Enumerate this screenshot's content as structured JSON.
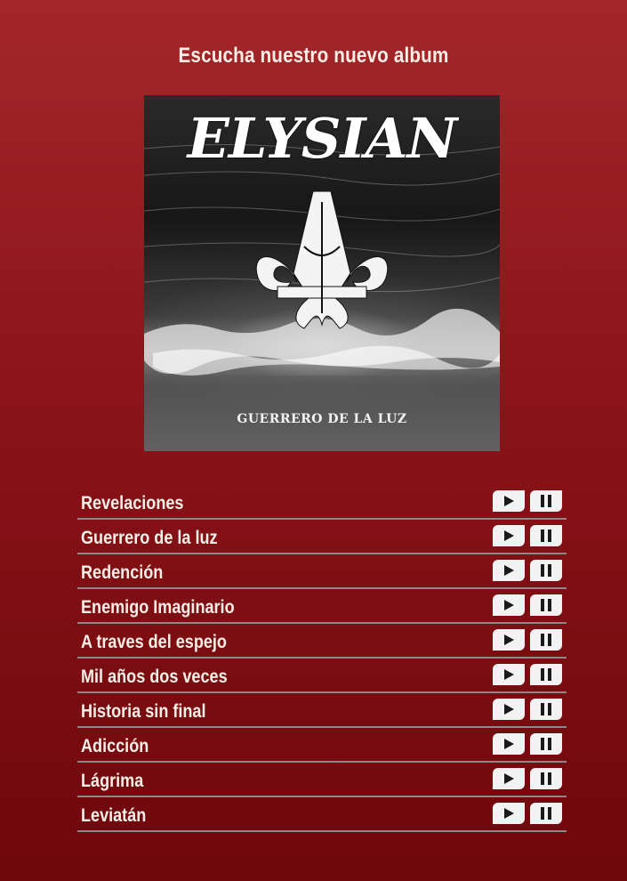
{
  "header": {
    "title": "Escucha nuestro nuevo album"
  },
  "album": {
    "band_name": "ELYSIAN",
    "album_title": "GUERRERO DE LA LUZ"
  },
  "tracks": [
    {
      "name": "Revelaciones"
    },
    {
      "name": "Guerrero de la luz"
    },
    {
      "name": "Redención"
    },
    {
      "name": "Enemigo Imaginario"
    },
    {
      "name": "A traves del espejo"
    },
    {
      "name": "Mil años dos veces"
    },
    {
      "name": "Historia sin final"
    },
    {
      "name": "Adicción"
    },
    {
      "name": "Lágrima"
    },
    {
      "name": "Leviatán"
    }
  ],
  "icons": {
    "play": "play-icon",
    "pause": "pause-icon"
  },
  "colors": {
    "background_top": "#a4262a",
    "background_bottom": "#6e070c",
    "button": "#f2f2f2",
    "divider": "#8a8a8a"
  }
}
